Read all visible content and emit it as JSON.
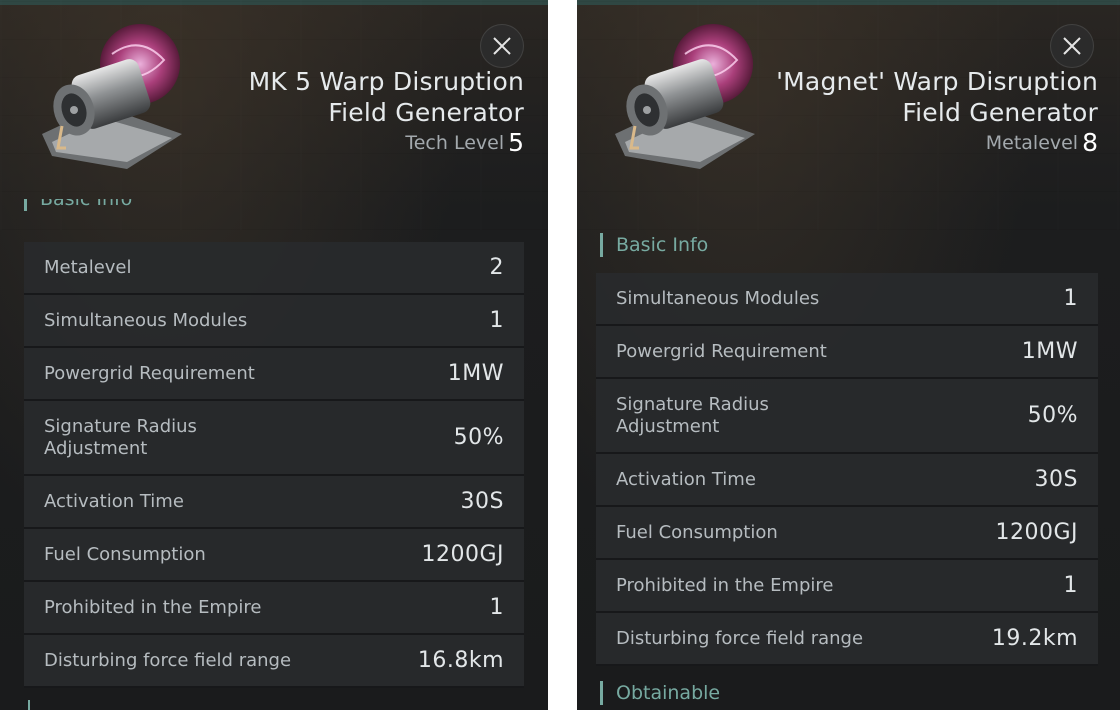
{
  "left_panel": {
    "title_line1": "MK 5 Warp Disruption",
    "title_line2": "Field Generator",
    "level_label": "Tech Level",
    "level_value": "5",
    "section_label": "Basic Info",
    "rows": [
      {
        "label": "Metalevel",
        "value": "2"
      },
      {
        "label": "Simultaneous Modules",
        "value": "1"
      },
      {
        "label": "Powergrid Requirement",
        "value": "1MW"
      },
      {
        "label_line1": "Signature Radius",
        "label_line2": "Adjustment",
        "value": "50%"
      },
      {
        "label": "Activation Time",
        "value": "30S"
      },
      {
        "label": "Fuel Consumption",
        "value": "1200GJ"
      },
      {
        "label": "Prohibited in the Empire",
        "value": "1"
      },
      {
        "label": "Disturbing force field range",
        "value": "16.8km"
      }
    ]
  },
  "right_panel": {
    "title_line1": "'Magnet' Warp Disruption",
    "title_line2": "Field Generator",
    "level_label": "Metalevel",
    "level_value": "8",
    "section_label": "Basic Info",
    "rows": [
      {
        "label": "Simultaneous Modules",
        "value": "1"
      },
      {
        "label": "Powergrid Requirement",
        "value": "1MW"
      },
      {
        "label_line1": "Signature Radius",
        "label_line2": "Adjustment",
        "value": "50%"
      },
      {
        "label": "Activation Time",
        "value": "30S"
      },
      {
        "label": "Fuel Consumption",
        "value": "1200GJ"
      },
      {
        "label": "Prohibited in the Empire",
        "value": "1"
      },
      {
        "label": "Disturbing force field range",
        "value": "19.2km"
      }
    ],
    "next_section_label": "Obtainable"
  },
  "icons": {
    "close": "close-icon",
    "item": "warp-disruption-field-generator-icon"
  },
  "colors": {
    "accent": "#77aaa1",
    "row_bg": "#282a2c",
    "panel_bg": "#1a1b1c"
  }
}
